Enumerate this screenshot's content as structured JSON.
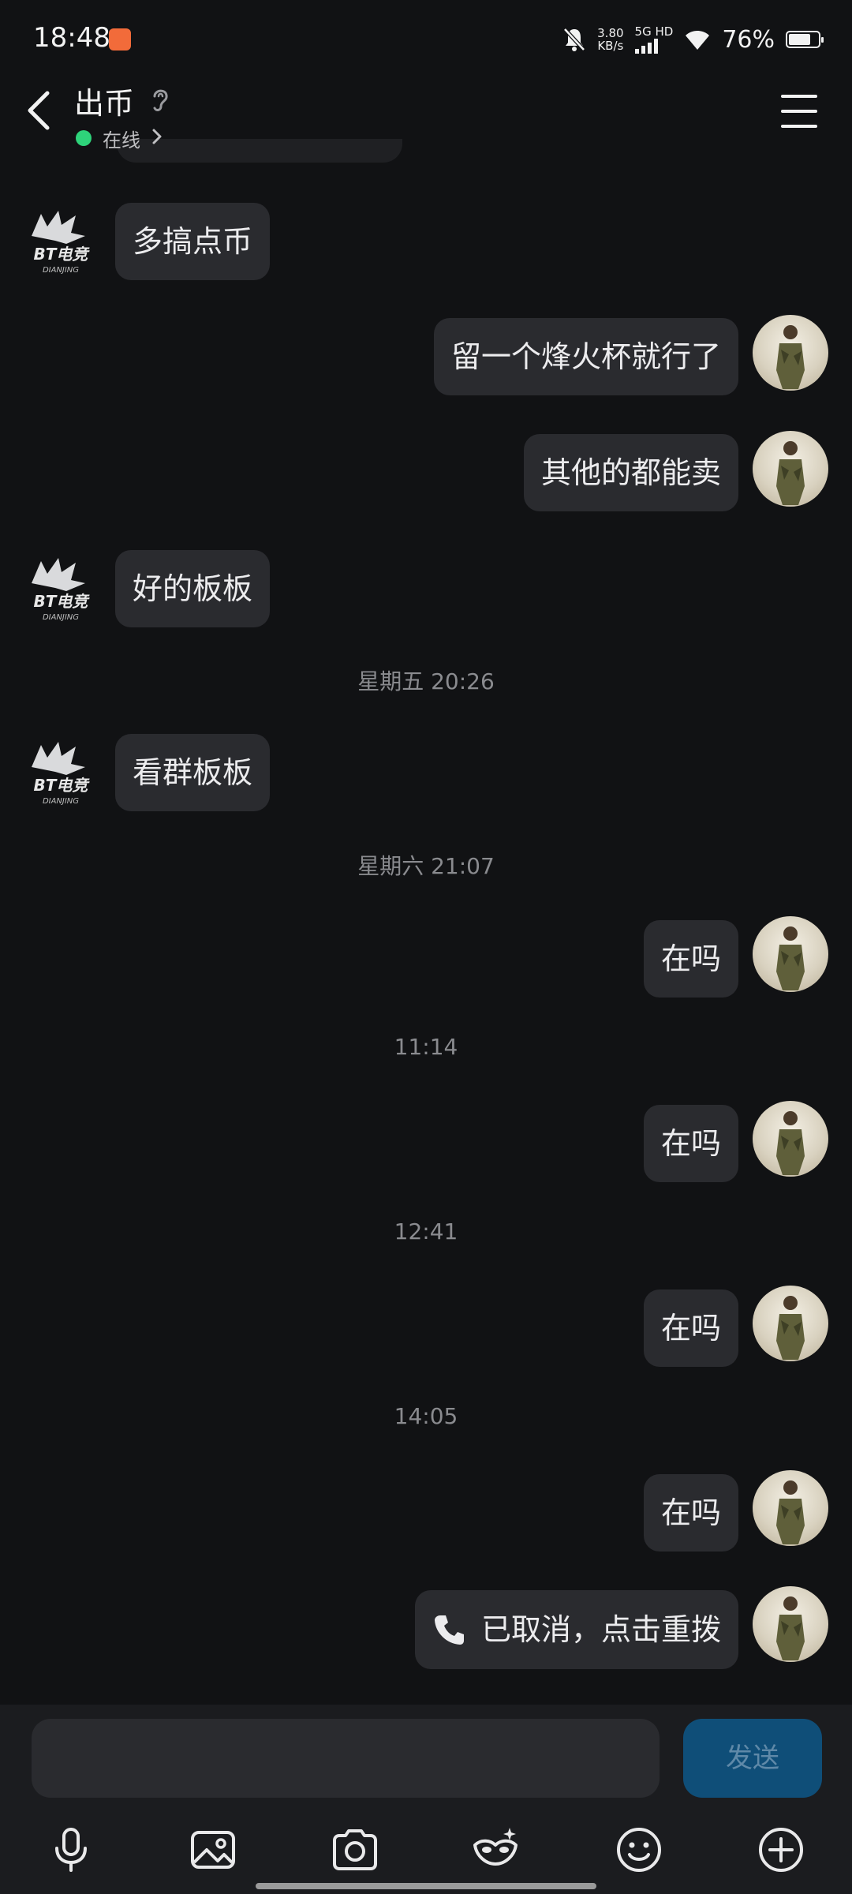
{
  "status_bar": {
    "time": "18:48",
    "net_speed_value": "3.80",
    "net_speed_unit": "KB/s",
    "network_type": "5G HD",
    "battery_percent": "76%",
    "battery_level": 0.76,
    "icons": [
      "app-notification-icon",
      "mute-bell-icon",
      "signal-icon",
      "wifi-icon",
      "battery-icon"
    ]
  },
  "header": {
    "title": "出币",
    "status": "在线",
    "icons": [
      "back-icon",
      "ear-icon",
      "chevron-right-icon",
      "menu-icon"
    ]
  },
  "messages": [
    {
      "side": "left",
      "text": "多搞点币"
    },
    {
      "side": "right",
      "text": "留一个烽火杯就行了"
    },
    {
      "side": "right",
      "text": "其他的都能卖"
    },
    {
      "side": "left",
      "text": "好的板板"
    },
    {
      "timestamp": "星期五 20:26"
    },
    {
      "side": "left",
      "text": "看群板板"
    },
    {
      "timestamp": "星期六 21:07"
    },
    {
      "side": "right",
      "text": "在吗"
    },
    {
      "timestamp": "11:14"
    },
    {
      "side": "right",
      "text": "在吗"
    },
    {
      "timestamp": "12:41"
    },
    {
      "side": "right",
      "text": "在吗"
    },
    {
      "timestamp": "14:05"
    },
    {
      "side": "right",
      "text": "在吗"
    },
    {
      "side": "right",
      "type": "call",
      "text": "已取消，点击重拨"
    }
  ],
  "left_avatar_text": {
    "main": "BT电竞",
    "sub": "DIANJING"
  },
  "input_bar": {
    "value": "",
    "send_label": "发送",
    "tools": [
      "microphone-icon",
      "image-icon",
      "camera-icon",
      "magic-mask-icon",
      "emoji-icon",
      "plus-icon"
    ]
  },
  "colors": {
    "background": "#111214",
    "bubble": "#2a2b2f",
    "online": "#2ed37a",
    "send_button": "#0f4e78"
  }
}
